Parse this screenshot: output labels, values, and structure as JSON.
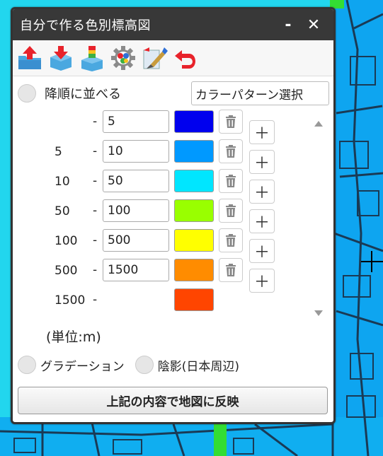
{
  "dialog": {
    "title": "自分で作る色別標高図",
    "minimize_label": "-",
    "close_label": "✕"
  },
  "toolbar": {
    "tools": [
      "upload-icon",
      "download-icon",
      "layer-add-icon",
      "settings-icon",
      "edit-brush-icon",
      "undo-icon"
    ]
  },
  "sort": {
    "label": "降順に並べる",
    "checked": false
  },
  "pattern_button": {
    "label": "カラーパターン選択"
  },
  "color_rows": [
    {
      "lower": "",
      "dash": "-",
      "value": "5",
      "color": "#0000ee"
    },
    {
      "lower": "5",
      "dash": "-",
      "value": "10",
      "color": "#0099ff"
    },
    {
      "lower": "10",
      "dash": "-",
      "value": "50",
      "color": "#00e6ff"
    },
    {
      "lower": "50",
      "dash": "-",
      "value": "100",
      "color": "#99ff00"
    },
    {
      "lower": "100",
      "dash": "-",
      "value": "500",
      "color": "#ffff00"
    },
    {
      "lower": "500",
      "dash": "-",
      "value": "1500",
      "color": "#ff8c00"
    },
    {
      "lower": "1500",
      "dash": "-",
      "value": "",
      "color": "#ff4500"
    }
  ],
  "unit_label": "(単位:m)",
  "options": {
    "gradation_label": "グラデーション",
    "shade_label": "陰影(日本周辺)"
  },
  "apply_button": {
    "label": "上記の内容で地図に反映"
  },
  "colors": {
    "titlebar": "#383838",
    "map_water": "#20d8f0",
    "map_line": "#1a3a55"
  }
}
